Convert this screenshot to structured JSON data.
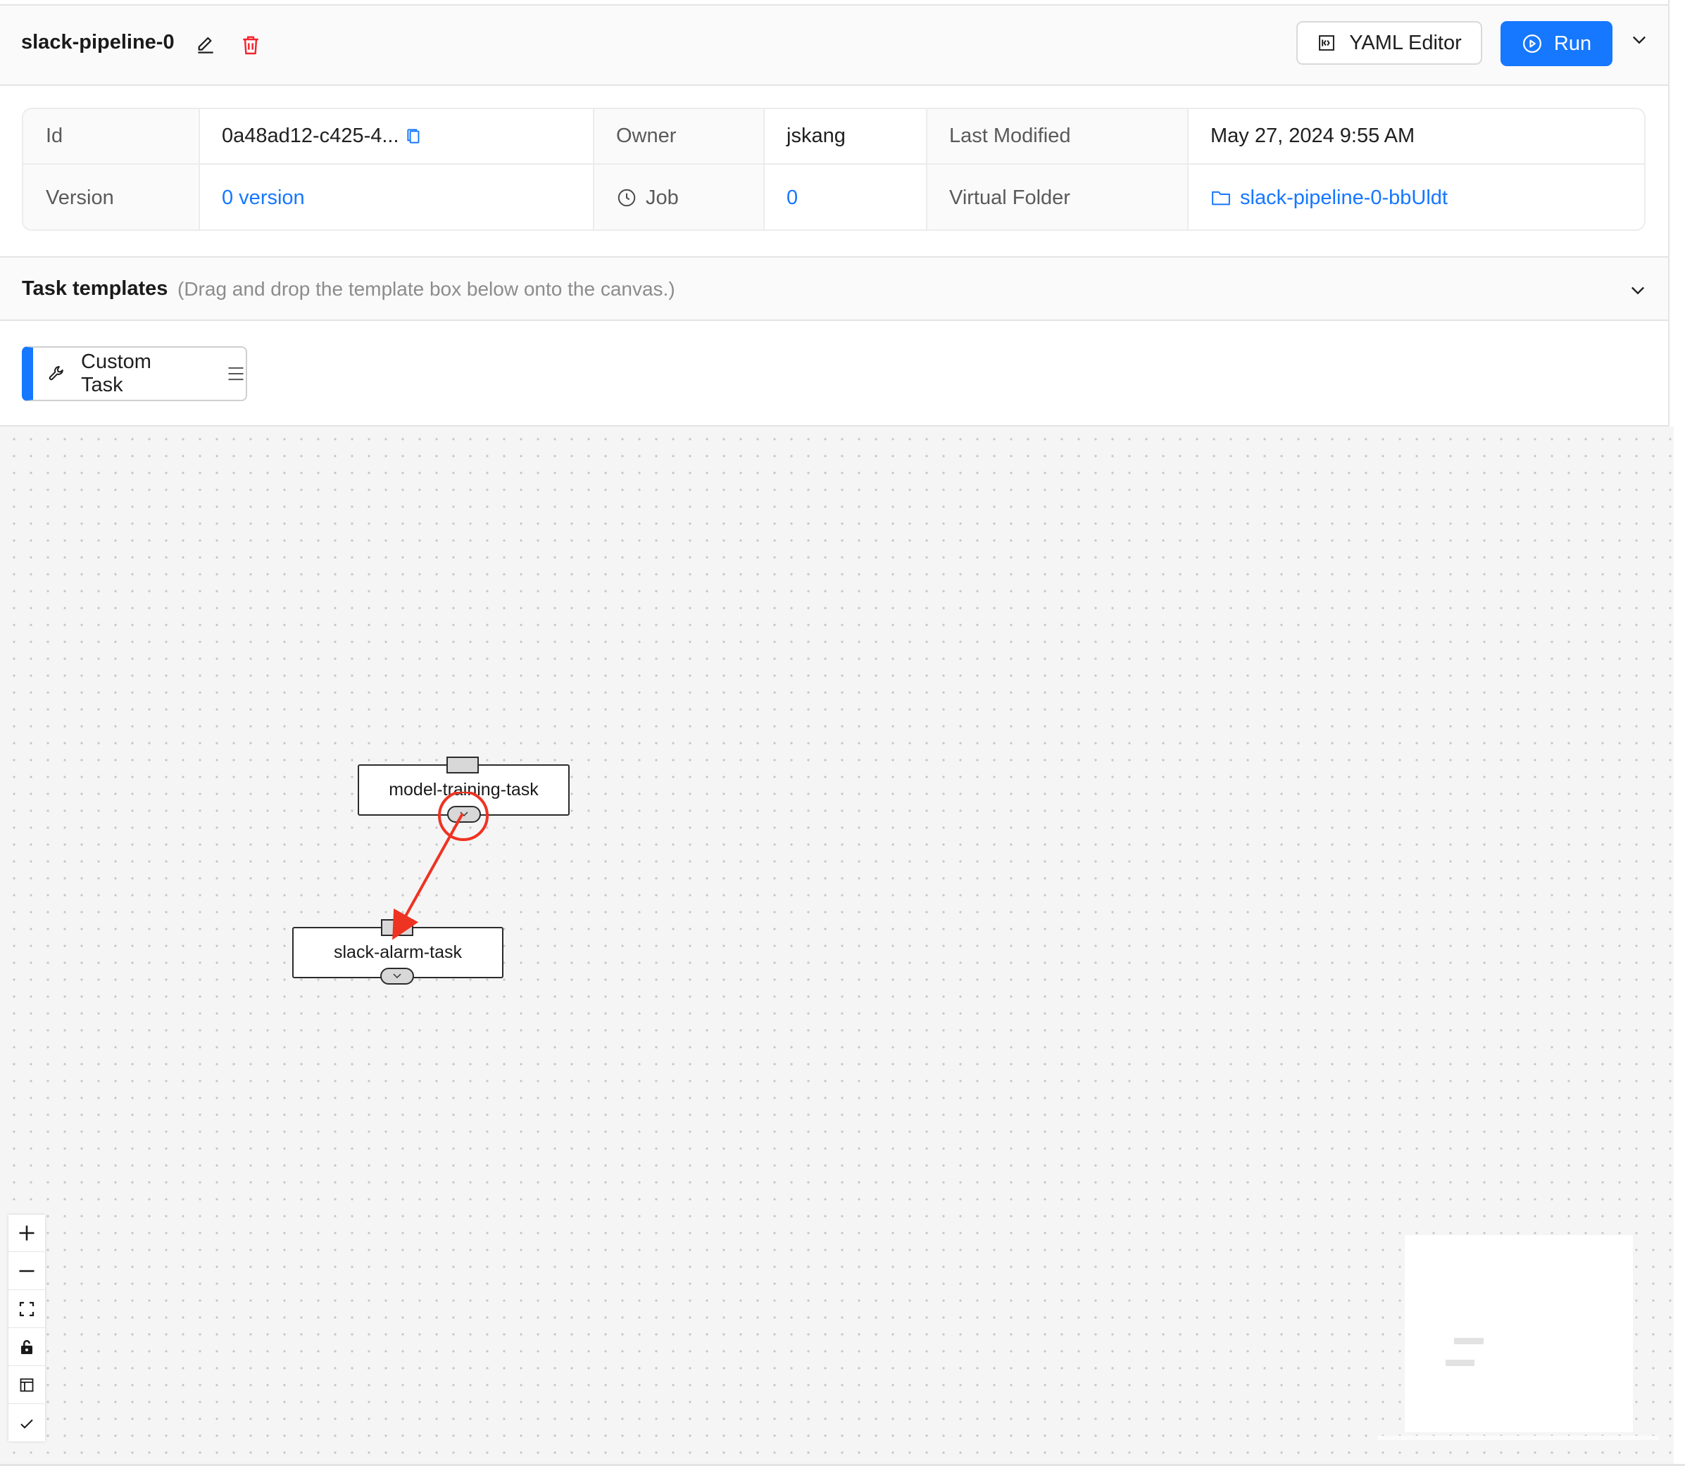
{
  "pipeline": {
    "name": "slack-pipeline-0",
    "icons": {
      "edit": "pencil-icon",
      "delete": "trash-icon"
    }
  },
  "header": {
    "yaml_editor_label": "YAML Editor",
    "run_label": "Run",
    "icons": {
      "yaml": "code-editor-icon",
      "run": "play-circle-icon",
      "more": "chevron-down-icon"
    }
  },
  "info": {
    "id_label": "Id",
    "id_value": "0a48ad12-c425-4...",
    "owner_label": "Owner",
    "owner_value": "jskang",
    "last_modified_label": "Last Modified",
    "last_modified_value": "May 27, 2024 9:55 AM",
    "version_label": "Version",
    "version_value": "0 version",
    "job_label": "Job",
    "job_value": "0",
    "virtual_folder_label": "Virtual Folder",
    "virtual_folder_value": "slack-pipeline-0-bbUldt"
  },
  "task_templates": {
    "title": "Task templates",
    "hint": "(Drag and drop the template box below onto the canvas.)",
    "items": [
      {
        "label": "Custom Task",
        "icon": "wrench-icon"
      }
    ]
  },
  "canvas": {
    "nodes": [
      {
        "label": "model-training-task"
      },
      {
        "label": "slack-alarm-task"
      }
    ],
    "edges": [
      {
        "from": "model-training-task",
        "to": "slack-alarm-task"
      }
    ],
    "controls": [
      "zoom-in-icon",
      "zoom-out-icon",
      "fit-view-icon",
      "lock-icon",
      "layout-icon",
      "check-icon"
    ]
  },
  "colors": {
    "accent": "#1677ff",
    "danger": "#f5222d",
    "annotation": "#ee3322"
  }
}
